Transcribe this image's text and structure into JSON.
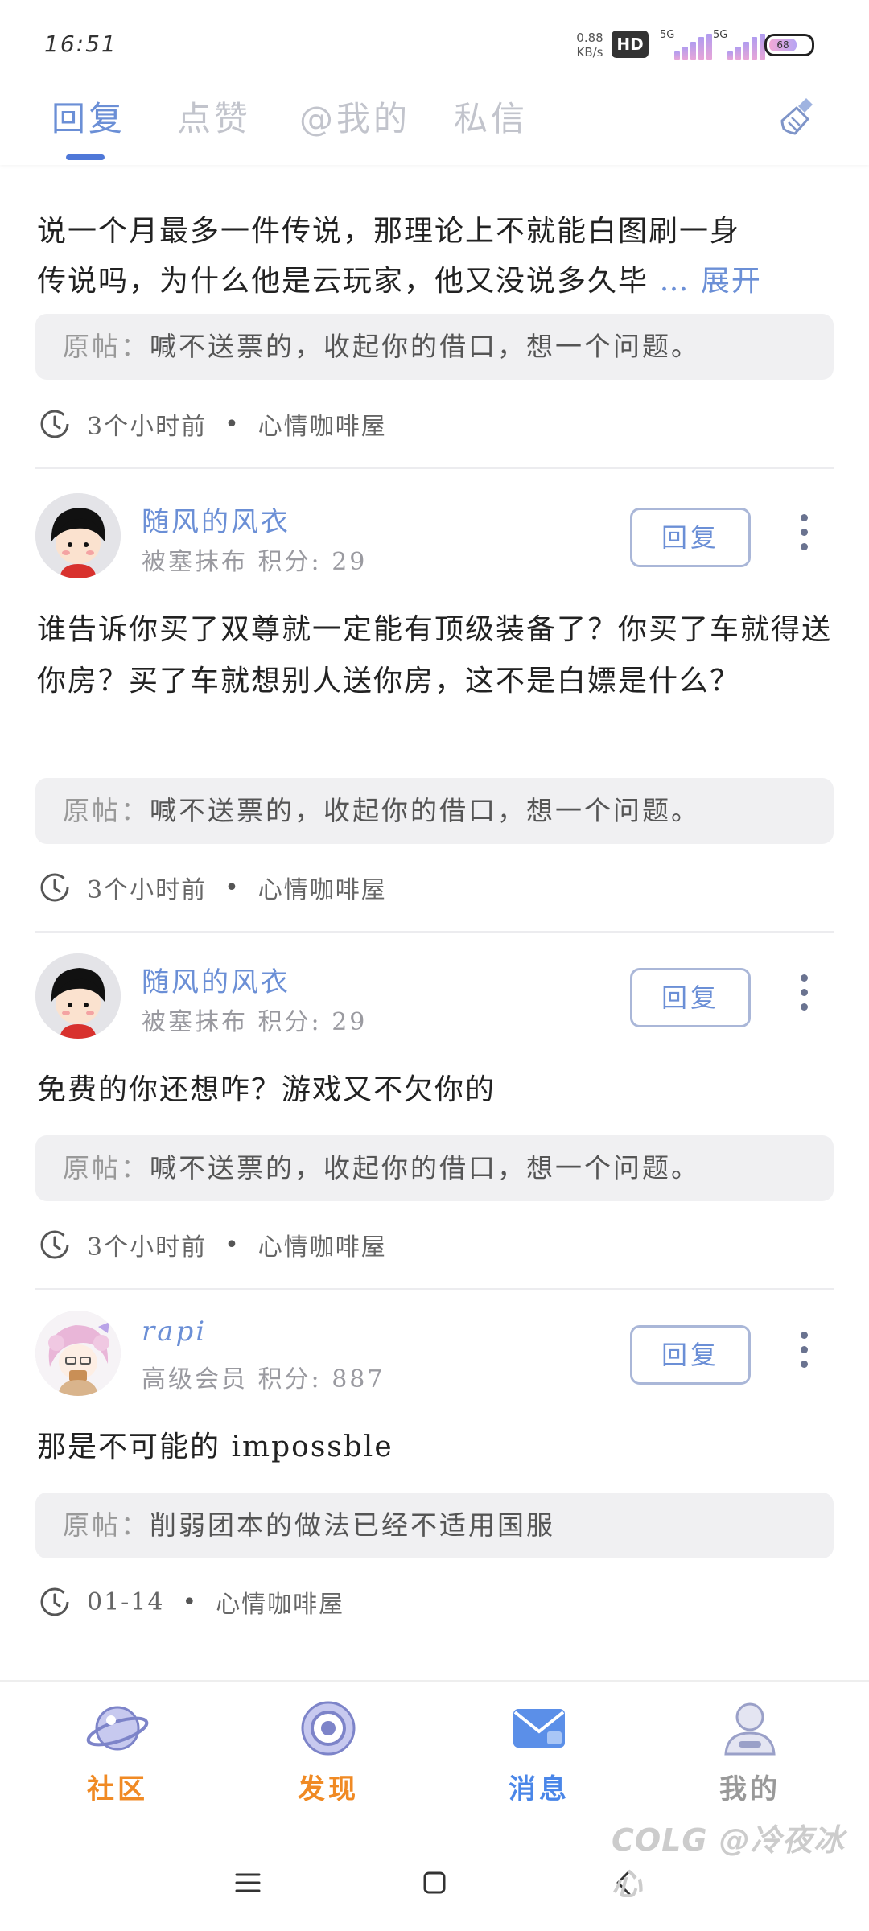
{
  "status_bar": {
    "time": "16:51",
    "net_speed_value": "0.88",
    "net_speed_unit": "KB/s",
    "hd_label": "HD",
    "network_1": "5G",
    "network_2": "5G",
    "battery_level": "68"
  },
  "tabs": [
    {
      "label": "回复",
      "active": true
    },
    {
      "label": "点赞",
      "active": false
    },
    {
      "label": "@我的",
      "active": false
    },
    {
      "label": "私信",
      "active": false
    }
  ],
  "partial_card": {
    "text_line1": "说一个月最多一件传说，那理论上不就能白图刷一身",
    "text_line2": "传说吗，为什么他是云玩家，他又没说多久毕",
    "expand_label": "… 展开",
    "quote_label": "原帖：",
    "quote_text": "喊不送票的，收起你的借口，想一个问题。",
    "time": "3个小时前",
    "board": "心情咖啡屋"
  },
  "cards": [
    {
      "username": "随风的风衣",
      "user_title": "被塞抹布",
      "score_label": "积分:",
      "score": "29",
      "reply_label": "回复",
      "content": "谁告诉你买了双尊就一定能有顶级装备了？你买了车就得送你房？买了车就想别人送你房，这不是白嫖是什么？",
      "quote_label": "原帖：",
      "quote_text": "喊不送票的，收起你的借口，想一个问题。",
      "time": "3个小时前",
      "board": "心情咖啡屋"
    },
    {
      "username": "随风的风衣",
      "user_title": "被塞抹布",
      "score_label": "积分:",
      "score": "29",
      "reply_label": "回复",
      "content": "免费的你还想咋？游戏又不欠你的",
      "quote_label": "原帖：",
      "quote_text": "喊不送票的，收起你的借口，想一个问题。",
      "time": "3个小时前",
      "board": "心情咖啡屋"
    },
    {
      "username": "rapi",
      "user_title": "高级会员",
      "score_label": "积分:",
      "score": "887",
      "reply_label": "回复",
      "content": "那是不可能的 impossble",
      "quote_label": "原帖：",
      "quote_text": "削弱团本的做法已经不适用国服",
      "time": "01-14",
      "board": "心情咖啡屋"
    }
  ],
  "bottom_nav": [
    {
      "label": "社区",
      "icon": "planet-icon",
      "color": "#f08a24"
    },
    {
      "label": "发现",
      "icon": "target-icon",
      "color": "#f08a24"
    },
    {
      "label": "消息",
      "icon": "mail-icon",
      "color": "#4a86e8",
      "active": true
    },
    {
      "label": "我的",
      "icon": "user-icon",
      "color": "#999999"
    }
  ],
  "watermark": "COLG @冷夜冰心",
  "colors": {
    "accent": "#6b8fd6",
    "tab_inactive": "#c2c4cc",
    "orange": "#f08a24"
  }
}
